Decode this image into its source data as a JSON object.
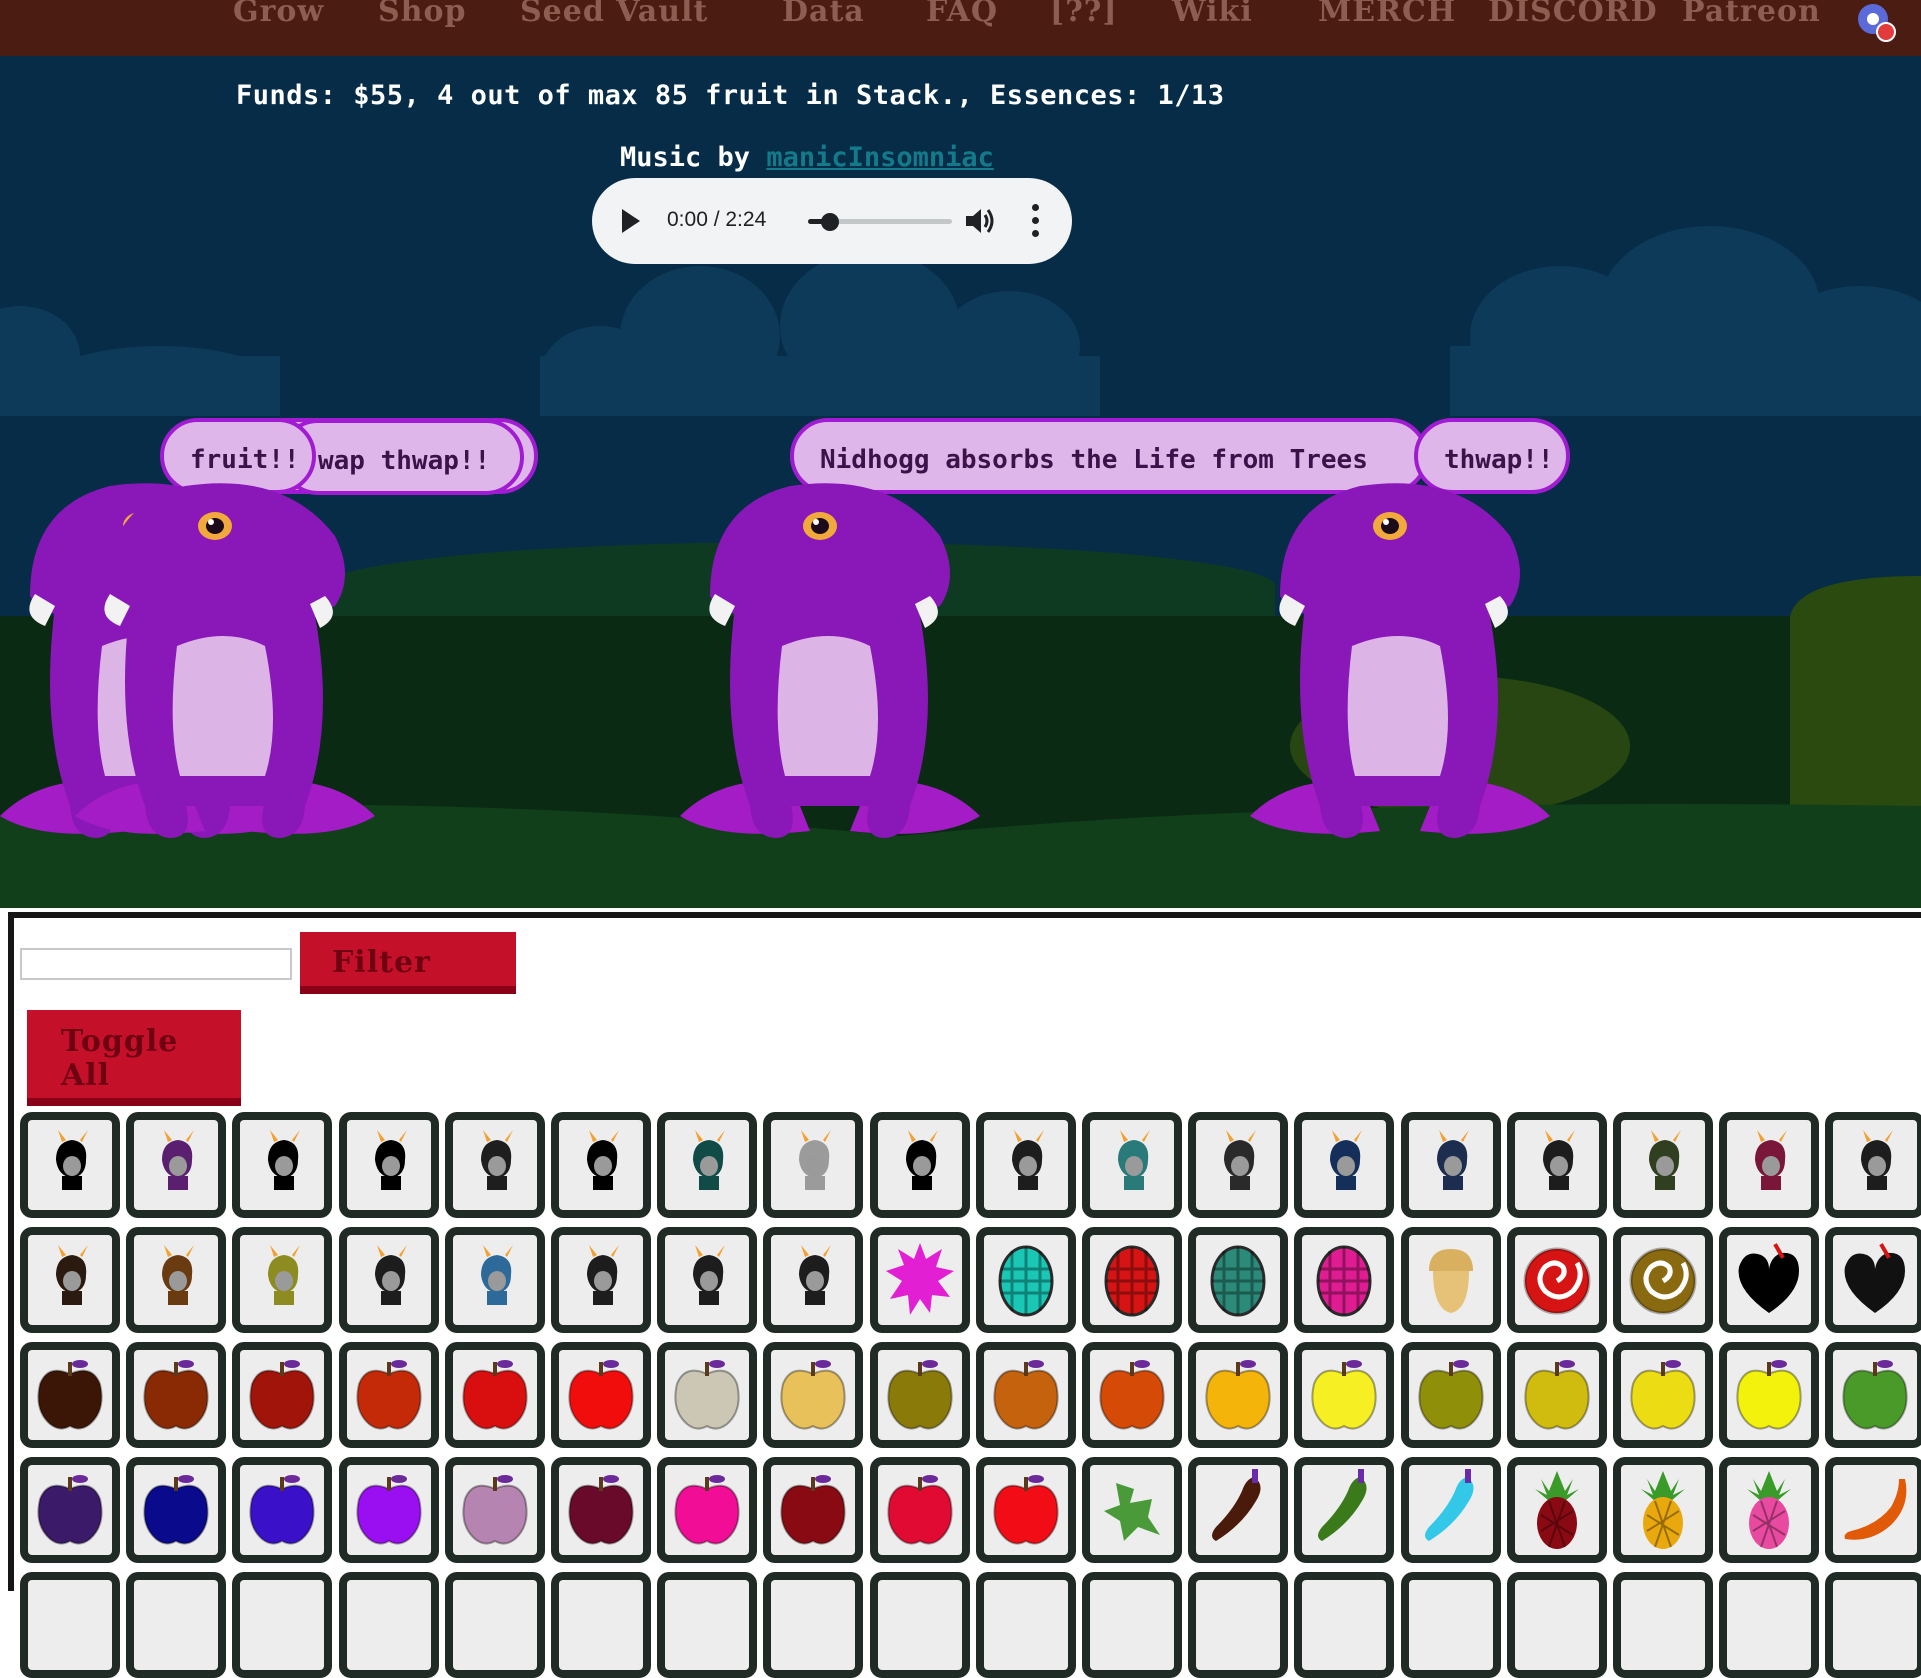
{
  "nav": {
    "items": [
      "Grow",
      "Shop",
      "Seed Vault",
      "Data",
      "FAQ",
      "[??]",
      "Wiki",
      "MERCH",
      "DISCORD",
      "Patreon"
    ],
    "extension_icon": "browser-extension-icon"
  },
  "status": {
    "funds_text": "Funds: $55, 4 out of max 85 fruit in Stack., Essences: 1/13"
  },
  "music": {
    "prefix": "Music by",
    "artist": "manicInsomniac",
    "time": "0:00 / 2:24",
    "progress": 0.15
  },
  "bubbles": {
    "left_front": "fruit!!",
    "left_back": "wap thwap!!",
    "center": "Nidhogg absorbs the Life from Trees",
    "right": "thwap!!"
  },
  "filter": {
    "input_value": "",
    "filter_label": "Filter",
    "toggle_line1": "Toggle",
    "toggle_line2": "All"
  },
  "colors": {
    "nav_bg": "#4a1c12",
    "scene_bg": "#062c48",
    "accent_red": "#c5102a",
    "nidhogg_purple": "#8a17b8",
    "bubble_fill": "#dfb6e9"
  },
  "grid": {
    "rows": [
      [
        "troll-icon",
        "troll-icon",
        "troll-icon",
        "troll-icon",
        "troll-icon",
        "troll-icon",
        "troll-icon",
        "troll-icon",
        "troll-icon",
        "troll-icon",
        "troll-icon",
        "troll-icon",
        "troll-icon",
        "troll-icon",
        "troll-icon",
        "troll-icon",
        "troll-icon",
        "troll-icon"
      ],
      [
        "troll-icon",
        "troll-icon",
        "troll-icon",
        "troll-icon",
        "troll-icon",
        "troll-icon",
        "troll-icon",
        "troll-icon",
        "spiky-fruit-icon",
        "egg-fruit-icon",
        "egg-fruit-icon",
        "egg-fruit-icon",
        "egg-fruit-icon",
        "acorn-icon",
        "spiral-fruit-icon",
        "spiral-fruit-icon",
        "heart-fruit-icon",
        "heart-fruit-icon"
      ],
      [
        "apple-icon",
        "apple-icon",
        "apple-icon",
        "apple-icon",
        "apple-icon",
        "apple-icon",
        "apple-icon",
        "apple-icon",
        "apple-icon",
        "apple-icon",
        "apple-icon",
        "apple-icon",
        "apple-icon",
        "apple-icon",
        "apple-icon",
        "apple-icon",
        "apple-icon",
        "apple-icon"
      ],
      [
        "apple-icon",
        "apple-icon",
        "apple-icon",
        "apple-icon",
        "apple-icon",
        "apple-icon",
        "apple-icon",
        "apple-icon",
        "apple-icon",
        "apple-icon",
        "leaf-creature-icon",
        "pepper-icon",
        "pepper-icon",
        "pepper-icon",
        "pineapple-icon",
        "pineapple-icon",
        "pineapple-icon",
        "banana-icon"
      ]
    ],
    "row_colors": [
      [
        "#000000",
        "#5a1f6f",
        "#000000",
        "#000000",
        "#1e1e1e",
        "#000000",
        "#114b47",
        "#9b9b9b",
        "#000000",
        "#1d1d1d",
        "#2a7a7a",
        "#2a2a2a",
        "#14305a",
        "#1d2d50",
        "#1d1d1d",
        "#2f3f20",
        "#7a163a",
        "#1d1d1d"
      ],
      [
        "#2a1a10",
        "#6a3a10",
        "#8c8c20",
        "#1d1d1d",
        "#2d6a9a",
        "#1d1d1d",
        "#1d1d1d",
        "#1d1d1d",
        "#e21fd3",
        "#1ac7b5",
        "#d61414",
        "#2b8a7a",
        "#df1c92",
        "#e5c277",
        "#d61414",
        "#8a6a10",
        "#000000",
        "#111111"
      ],
      [
        "#3b1606",
        "#8a2a04",
        "#a0140a",
        "#c42a08",
        "#d90f0f",
        "#f20d0d",
        "#ccc7b4",
        "#e8c15a",
        "#8a7a0a",
        "#c4620d",
        "#d44a06",
        "#f5b409",
        "#f5ef24",
        "#8f8f0a",
        "#cfbc0f",
        "#ecdc14",
        "#f2f20d",
        "#4a9a2a"
      ],
      [
        "#3b1a6a",
        "#0a0a8c",
        "#3a10c8",
        "#9a0ef2",
        "#b684b0",
        "#6a0a2a",
        "#f20d96",
        "#8a0a14",
        "#e00a32",
        "#f20d16",
        "#4a9a3a",
        "#4a1a0a",
        "#3a7a1a",
        "#34c8e8",
        "#8a0a14",
        "#e9a80e",
        "#e84aa0",
        "#e05a08"
      ]
    ]
  }
}
